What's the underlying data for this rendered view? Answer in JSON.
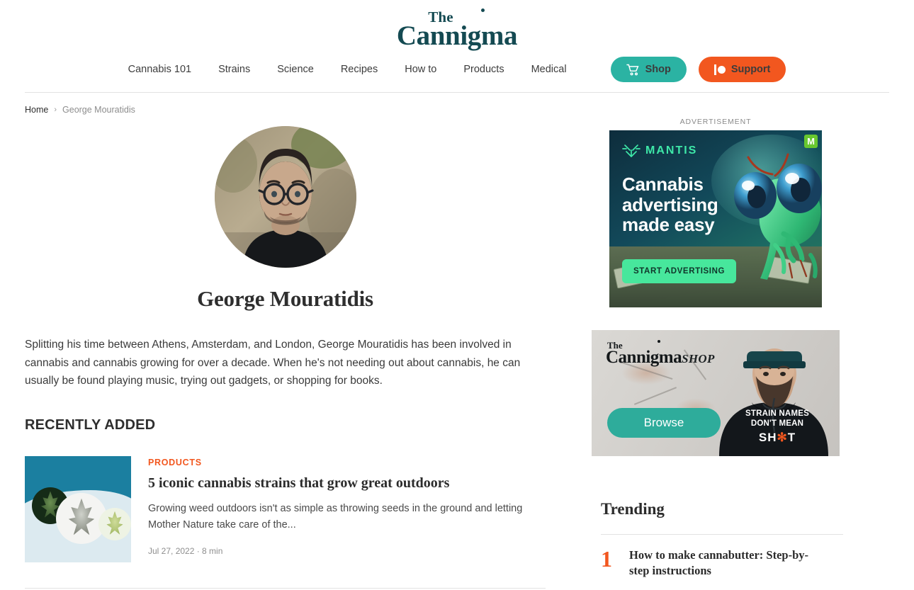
{
  "site": {
    "logo_the": "The",
    "logo_name": "Cannigma"
  },
  "nav": {
    "items": [
      {
        "label": "Cannabis 101"
      },
      {
        "label": "Strains"
      },
      {
        "label": "Science"
      },
      {
        "label": "Recipes"
      },
      {
        "label": "How to"
      },
      {
        "label": "Products"
      },
      {
        "label": "Medical"
      }
    ],
    "shop_label": "Shop",
    "support_label": "Support",
    "shop_color": "#2bb3a3",
    "support_color": "#f2571f"
  },
  "breadcrumb": {
    "home": "Home",
    "separator": "›",
    "current": "George Mouratidis"
  },
  "author": {
    "name": "George Mouratidis",
    "bio": "Splitting his time between Athens, Amsterdam, and London, George Mouratidis has been involved in cannabis and cannabis growing for over a decade. When he's not needing out about cannabis, he can usually be found playing music, trying out gadgets, or shopping for books."
  },
  "recently_added": {
    "heading": "RECENTLY ADDED",
    "articles": [
      {
        "category": "PRODUCTS",
        "title": "5 iconic cannabis strains that grow great outdoors",
        "excerpt": "Growing weed outdoors isn't as simple as throwing seeds in the ground and letting Mother Nature take care of the...",
        "date": "Jul 27, 2022",
        "read_time": "8 min",
        "meta": "Jul 27, 2022 · 8 min"
      }
    ]
  },
  "sidebar": {
    "ad_label": "ADVERTISEMENT",
    "ad": {
      "brand": "MANTIS",
      "headline_line1": "Cannabis",
      "headline_line2": "advertising",
      "headline_line3": "made easy",
      "cta": "START ADVERTISING",
      "badge": "M",
      "cta_color": "#47e79c"
    },
    "shop_banner": {
      "logo_the": "The",
      "logo_name": "Cannigma",
      "logo_shop": "SHOP",
      "browse_label": "Browse",
      "hoodie_line1": "STRAIN NAMES",
      "hoodie_line2": "DON'T MEAN",
      "hoodie_line3_pre": "SH",
      "hoodie_line3_leaf": "✻",
      "hoodie_line3_post": "T"
    },
    "trending": {
      "title": "Trending",
      "items": [
        {
          "rank": "1",
          "title": "How to make cannabutter: Step-by-step instructions"
        }
      ]
    }
  }
}
